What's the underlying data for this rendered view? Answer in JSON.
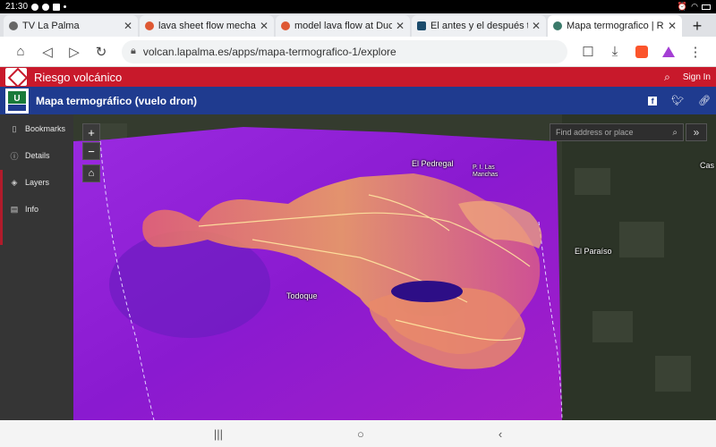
{
  "status_bar": {
    "time": "21:30"
  },
  "tabs": [
    {
      "title": "TV La Palma",
      "active": false
    },
    {
      "title": "lava sheet flow mechanic",
      "active": false
    },
    {
      "title": "model lava flow at DuckD",
      "active": false
    },
    {
      "title": "El antes y el después tras",
      "active": false
    },
    {
      "title": "Mapa termografico | Riesc",
      "active": true
    }
  ],
  "toolbar": {
    "url": "volcan.lapalma.es/apps/mapa-termografico-1/explore"
  },
  "app_header": {
    "title": "Riesgo volcánico",
    "sign_in": "Sign In"
  },
  "sub_header": {
    "title": "Mapa termográfico (vuelo dron)",
    "logo_text": "CABILDO LA PALMA"
  },
  "sidebar": {
    "items": [
      {
        "label": "Bookmarks",
        "icon": "bookmark-icon"
      },
      {
        "label": "Details",
        "icon": "info-circle-icon"
      },
      {
        "label": "Layers",
        "icon": "layers-icon"
      },
      {
        "label": "Info",
        "icon": "card-icon"
      }
    ]
  },
  "map": {
    "search_placeholder": "Find address or place",
    "places": {
      "pedregal": "El Pedregal",
      "las_manchas": "P. I. Las Manchas",
      "paraiso": "El Paraíso",
      "todoque": "Todoque",
      "cas": "Cas"
    }
  },
  "colors": {
    "brand_red": "#c8192b",
    "brand_blue": "#1f3b8f",
    "thermal_base": "#8f1fd6"
  }
}
